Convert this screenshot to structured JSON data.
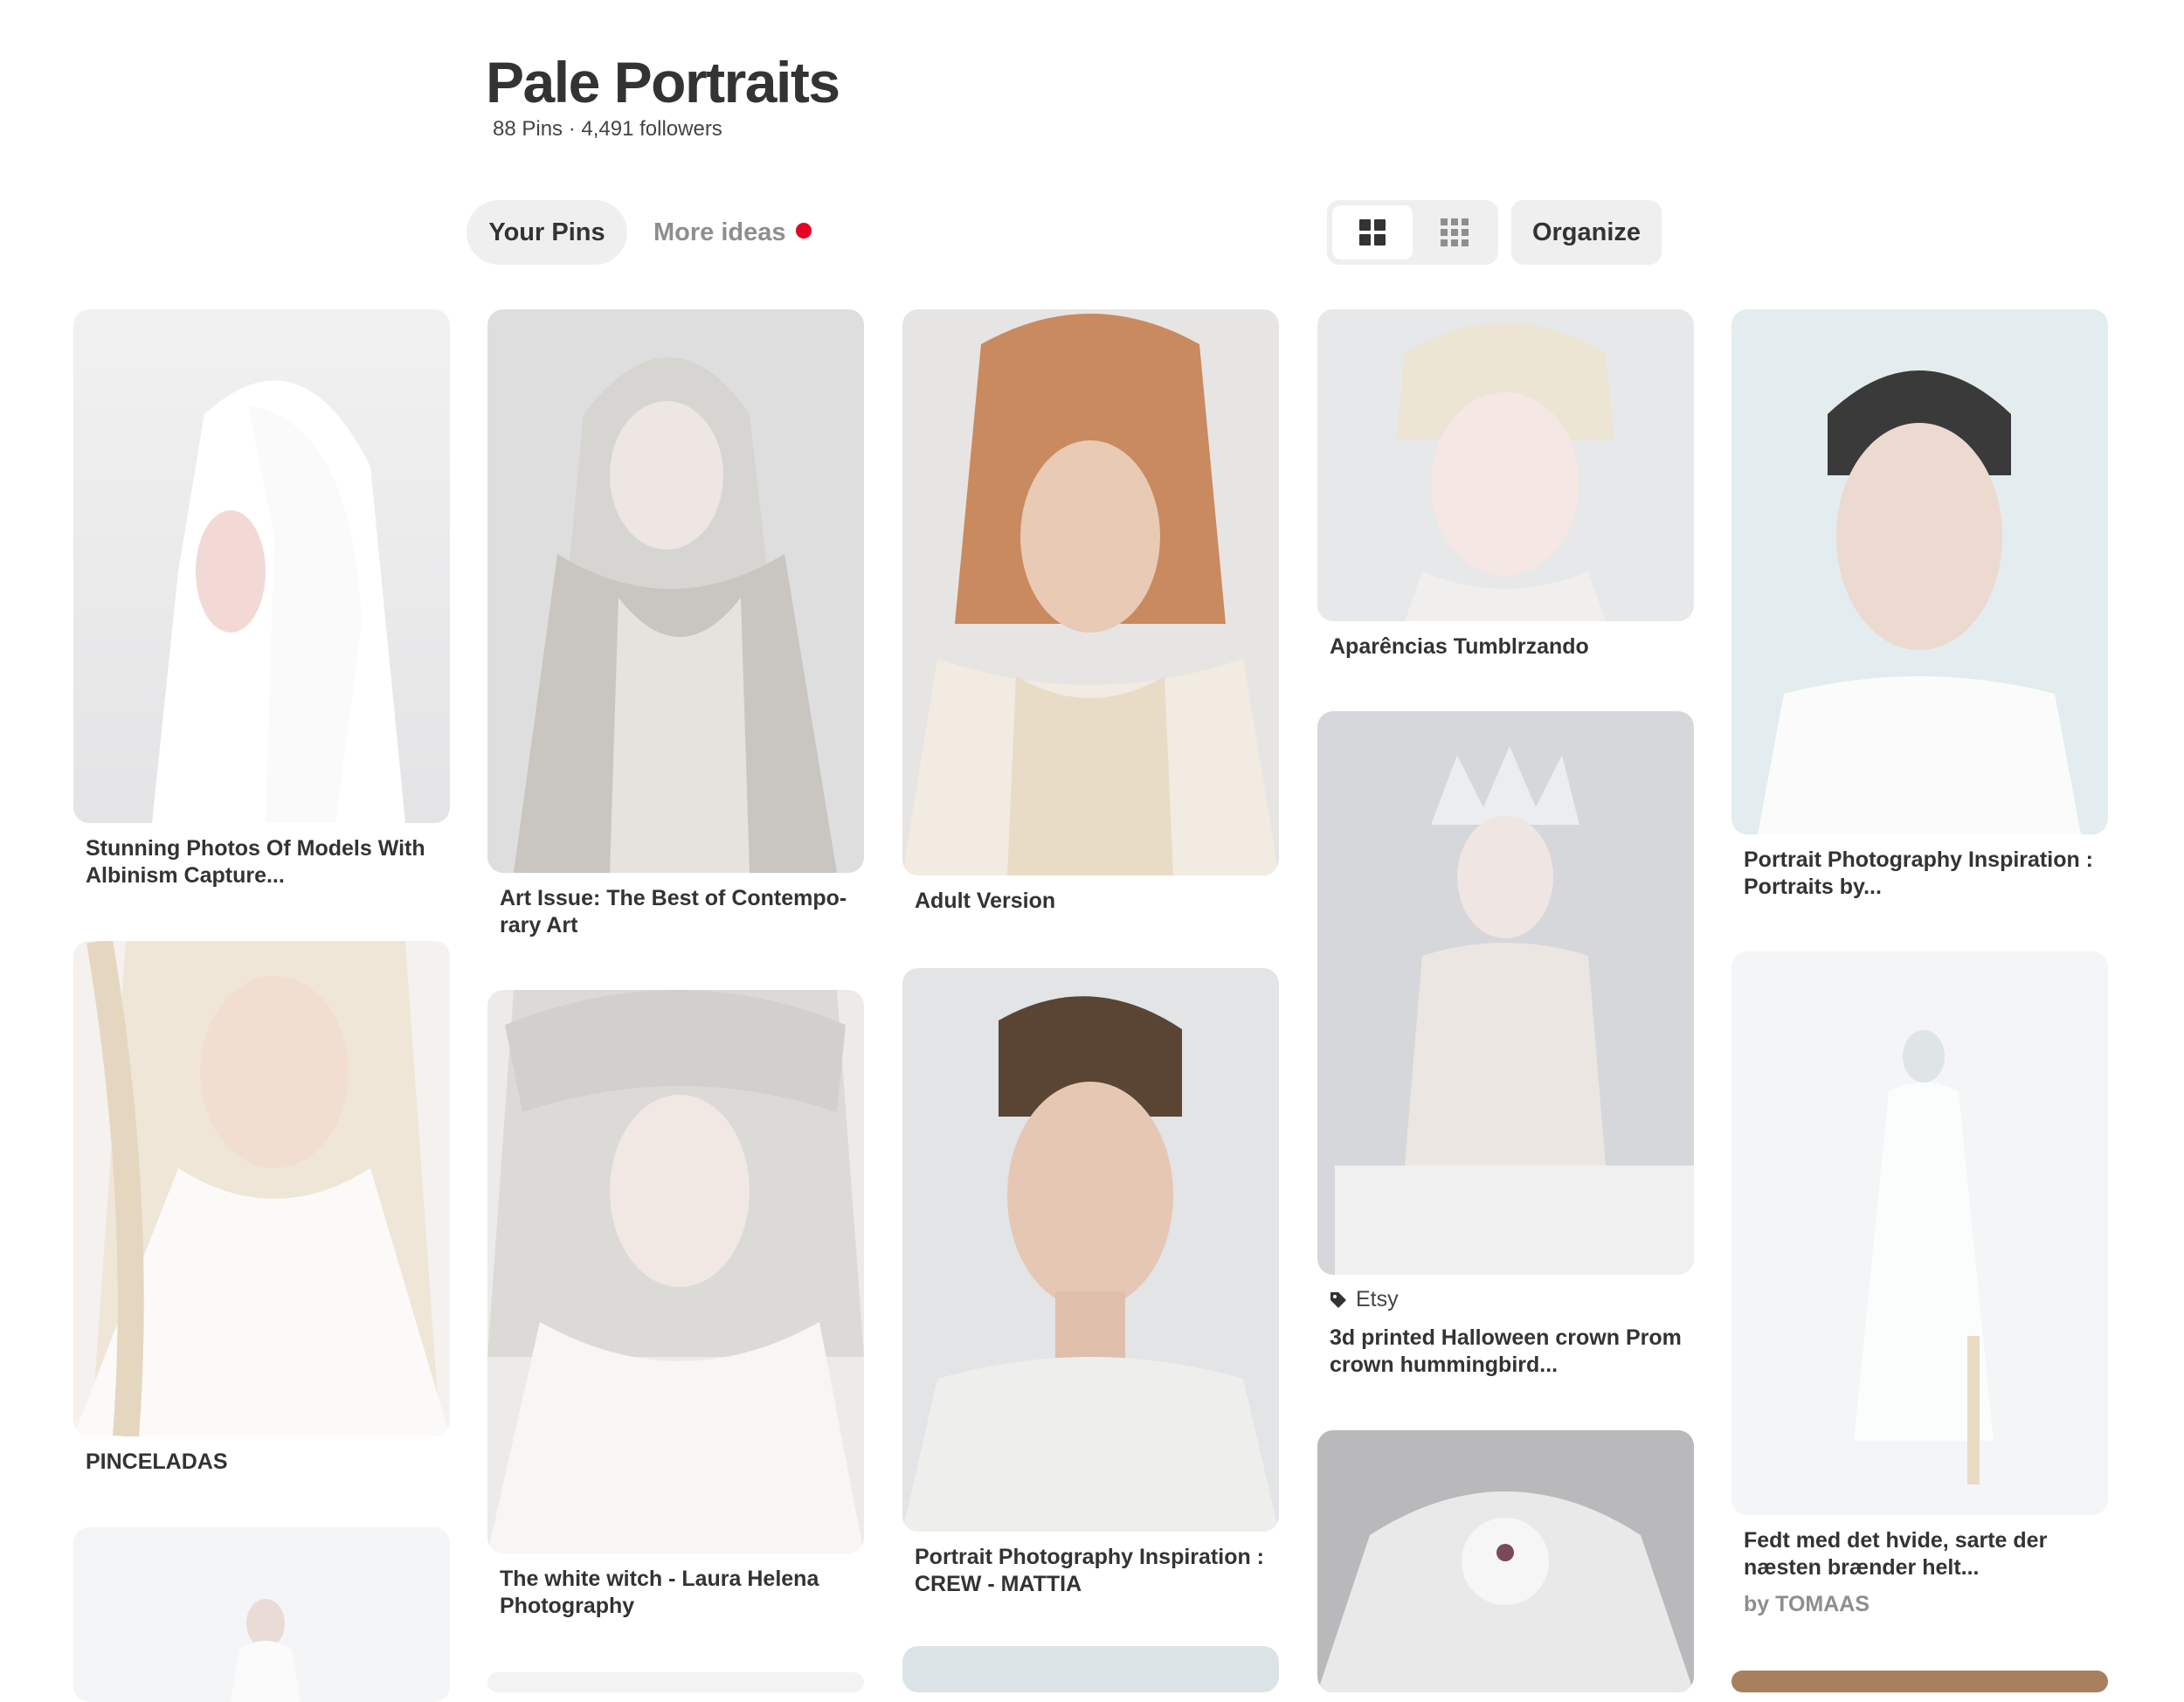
{
  "board": {
    "title": "Pale Portraits",
    "stats": "88 Pins · 4,491 followers"
  },
  "tabs": {
    "your_pins": "Your Pins",
    "more_ideas": "More ideas"
  },
  "toolbar": {
    "organize": "Organize",
    "view_default_icon": "grid-large-icon",
    "view_compact_icon": "grid-compact-icon"
  },
  "colors": {
    "accent_red": "#e60023",
    "chip_bg": "#efefef"
  },
  "pins": [
    {
      "title": "Stunning Photos Of Models With Albinism Capture..."
    },
    {
      "title": "PINCELADAS"
    },
    {
      "title": "Art Issue: The Best of Contempo-rary Art"
    },
    {
      "title": "The white witch - Laura Helena Photography"
    },
    {
      "title": "Adult Version"
    },
    {
      "title": "Portrait Photography Inspiration : CREW - MATTIA"
    },
    {
      "title": "Aparências Tumblrzando"
    },
    {
      "source": "Etsy",
      "title": "3d printed Halloween crown Prom crown hummingbird..."
    },
    {
      "title": "Portrait Photography Inspiration : Portraits by..."
    },
    {
      "title": "Fedt med det hvide, sarte der næsten brænder helt...",
      "attribution": "by TOMAAS"
    }
  ]
}
